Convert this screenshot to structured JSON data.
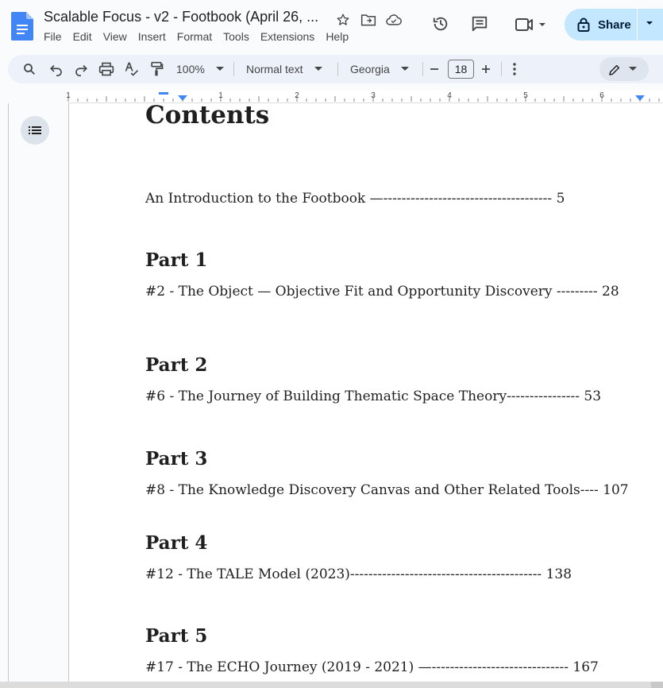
{
  "app": {
    "doc_title": "Scalable Focus - v2 - Footbook (April 26, ...",
    "menus": [
      "File",
      "Edit",
      "View",
      "Insert",
      "Format",
      "Tools",
      "Extensions",
      "Help"
    ],
    "share_label": "Share"
  },
  "toolbar": {
    "zoom": "100%",
    "style": "Normal text",
    "font": "Georgia",
    "font_size": "18"
  },
  "ruler": {
    "numbers": [
      "1",
      "1",
      "2",
      "3",
      "4",
      "5",
      "6"
    ]
  },
  "document": {
    "title": "Contents",
    "intro_entry": "An Introduction to the Footbook —------------------------------------- 5",
    "parts": [
      {
        "heading": "Part 1",
        "entry": "#2 - The Object — Objective Fit and Opportunity Discovery --------- 28"
      },
      {
        "heading": "Part 2",
        "entry": "#6 - The Journey of Building Thematic Space Theory---------------- 53"
      },
      {
        "heading": "Part 3",
        "entry": "#8 -  The Knowledge Discovery Canvas and Other Related Tools---- 107"
      },
      {
        "heading": "Part 4",
        "entry": "#12 - The TALE Model (2023)------------------------------------------ 138"
      },
      {
        "heading": "Part 5",
        "entry": "#17 - The ECHO Journey (2019 - 2021)  —------------------------------ 167"
      }
    ]
  },
  "colors": {
    "accent": "#4285f4",
    "share_bg": "#c2e7ff",
    "toolbar_bg": "#edf2fa"
  }
}
